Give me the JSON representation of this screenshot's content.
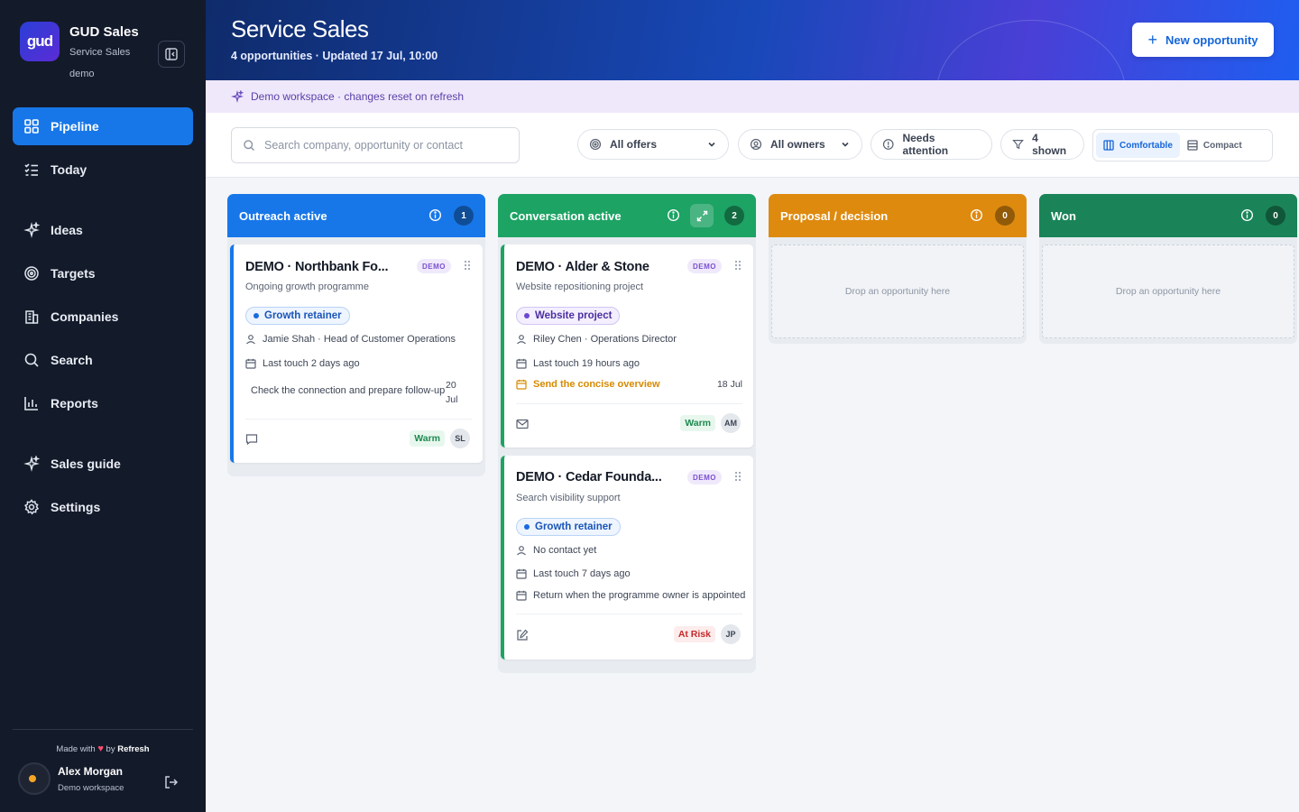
{
  "sidebar": {
    "logo_text": "gud",
    "brand_name": "GUD Sales",
    "brand_sub": "Service Sales",
    "workspace": "demo",
    "items": [
      {
        "label": "Pipeline",
        "icon": "grid-icon"
      },
      {
        "label": "Today",
        "icon": "checklist-icon"
      },
      {
        "label": "Ideas",
        "icon": "sparkle-icon"
      },
      {
        "label": "Targets",
        "icon": "target-icon"
      },
      {
        "label": "Companies",
        "icon": "building-icon"
      },
      {
        "label": "Search",
        "icon": "search-icon"
      },
      {
        "label": "Reports",
        "icon": "chart-icon"
      },
      {
        "label": "Sales guide",
        "icon": "sparkle-icon"
      },
      {
        "label": "Settings",
        "icon": "gear-icon"
      }
    ],
    "made_with_prefix": "Made with",
    "made_with_by": "by",
    "made_with_brand": "Refresh",
    "user_name": "Alex Morgan",
    "user_workspace": "Demo workspace"
  },
  "header": {
    "title": "Service Sales",
    "subtitle": "4 opportunities · Updated 17 Jul, 10:00",
    "new_button": "New opportunity"
  },
  "banner": "Demo workspace · changes reset on refresh",
  "toolbar": {
    "search_placeholder": "Search company, opportunity or contact",
    "offers": "All offers",
    "owners": "All owners",
    "attention": "Needs attention",
    "shown": "4 shown",
    "comfortable": "Comfortable",
    "compact": "Compact"
  },
  "columns": [
    {
      "title": "Outreach active",
      "count": "1",
      "color": "#1877e8"
    },
    {
      "title": "Conversation active",
      "count": "2",
      "color": "#1da364"
    },
    {
      "title": "Proposal / decision",
      "count": "0",
      "color": "#de8a0e",
      "empty": "Drop an opportunity here"
    },
    {
      "title": "Won",
      "count": "0",
      "color": "#1a8458",
      "empty": "Drop an opportunity here"
    }
  ],
  "cards": {
    "northbank": {
      "title": "DEMO · Northbank Fo...",
      "badge": "DEMO",
      "subtitle": "Ongoing growth programme",
      "tag": "Growth retainer",
      "contact": "Jamie Shah · Head of Customer Operations",
      "last_touch": "Last touch 2 days ago",
      "next_step": "Check the connection and prepare follow-up",
      "next_date": "20 Jul",
      "status": "Warm",
      "owner": "SL"
    },
    "alder": {
      "title": "DEMO · Alder & Stone",
      "badge": "DEMO",
      "subtitle": "Website repositioning project",
      "tag": "Website project",
      "contact": "Riley Chen · Operations Director",
      "last_touch": "Last touch 19 hours ago",
      "next_step": "Send the concise overview",
      "next_date": "18 Jul",
      "status": "Warm",
      "owner": "AM"
    },
    "cedar": {
      "title": "DEMO · Cedar Founda...",
      "badge": "DEMO",
      "subtitle": "Search visibility support",
      "tag": "Growth retainer",
      "contact": "No contact yet",
      "last_touch": "Last touch 7 days ago",
      "next_step": "Return when the programme owner is appointed",
      "status": "At Risk",
      "owner": "JP"
    }
  }
}
